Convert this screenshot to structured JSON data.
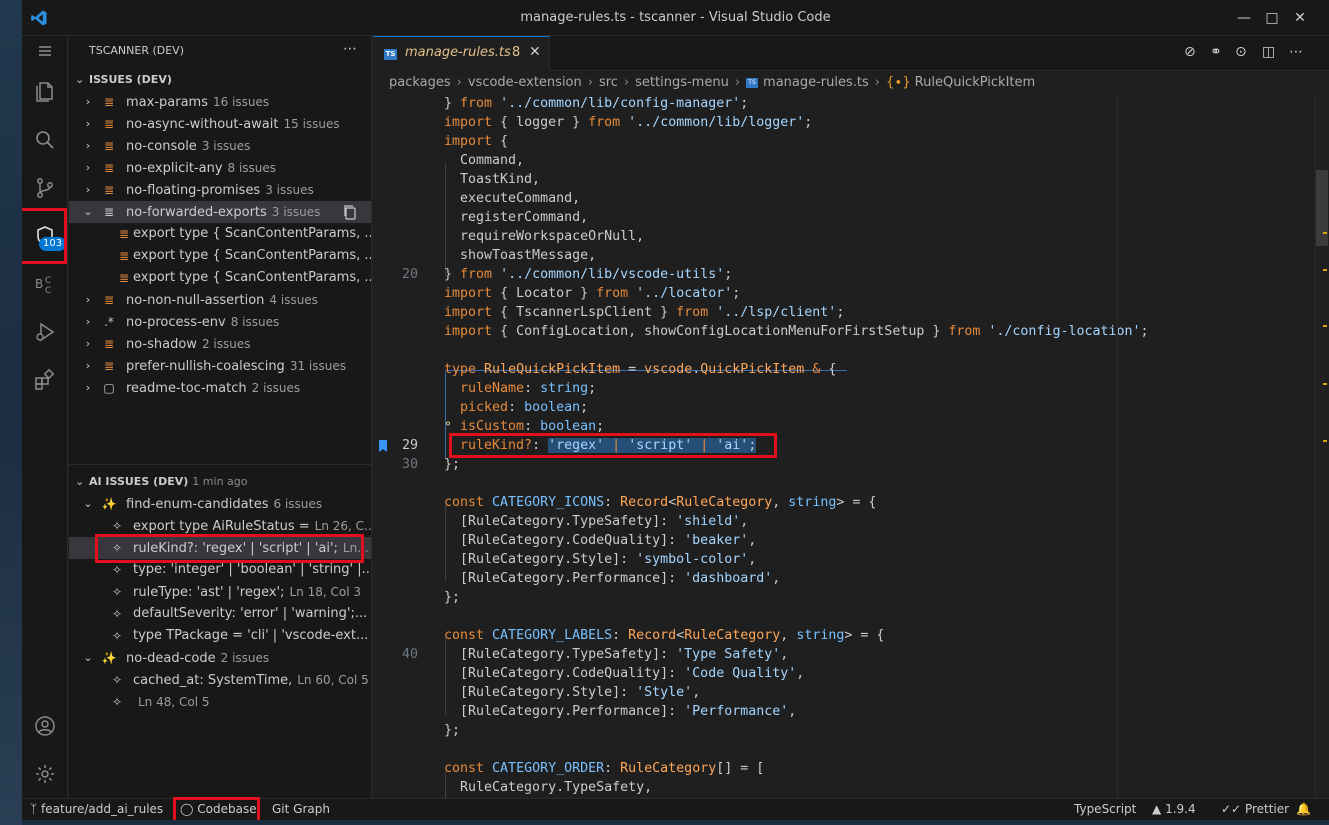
{
  "window": {
    "title": "manage-rules.ts - tscanner - Visual Studio Code"
  },
  "activity": {
    "badge": "103"
  },
  "sidebar": {
    "header": "TSCANNER (DEV)",
    "issues_section": "ISSUES (DEV)",
    "rules": [
      {
        "name": "max-params",
        "count": "16 issues"
      },
      {
        "name": "no-async-without-await",
        "count": "15 issues"
      },
      {
        "name": "no-console",
        "count": "3 issues"
      },
      {
        "name": "no-explicit-any",
        "count": "8 issues"
      },
      {
        "name": "no-floating-promises",
        "count": "3 issues"
      },
      {
        "name": "no-forwarded-exports",
        "count": "3 issues"
      }
    ],
    "forwarded_children": [
      "export type { ScanContentParams, ...",
      "export type { ScanContentParams, ...",
      "export type { ScanContentParams, ..."
    ],
    "rules2": [
      {
        "name": "no-non-null-assertion",
        "count": "4 issues"
      },
      {
        "name": "no-process-env",
        "count": "8 issues"
      },
      {
        "name": "no-shadow",
        "count": "2 issues"
      },
      {
        "name": "prefer-nullish-coalescing",
        "count": "31 issues"
      },
      {
        "name": "readme-toc-match",
        "count": "2 issues"
      }
    ],
    "ai_section": "AI ISSUES (DEV)",
    "ai_time": "1 min ago",
    "ai_rule1": {
      "name": "find-enum-candidates",
      "count": "6 issues"
    },
    "ai_items": [
      {
        "text": "export type AiRuleStatus =",
        "meta": "Ln 26, C..."
      },
      {
        "text": "ruleKind?: 'regex' | 'script' | 'ai';",
        "meta": "Ln..."
      },
      {
        "text": "type: 'integer' | 'boolean' | 'string' |...",
        "meta": ""
      },
      {
        "text": "ruleType: 'ast' | 'regex';",
        "meta": "Ln 18, Col 3"
      },
      {
        "text": "defaultSeverity: 'error' | 'warning';...",
        "meta": ""
      },
      {
        "text": "type TPackage = 'cli' | 'vscode-ext...",
        "meta": ""
      }
    ],
    "ai_rule2": {
      "name": "no-dead-code",
      "count": "2 issues"
    },
    "ai_items2": [
      {
        "text": "cached_at: SystemTime,",
        "meta": "Ln 60, Col 5"
      },
      {
        "text": "",
        "meta": "Ln 48, Col 5"
      }
    ]
  },
  "editor": {
    "tab": {
      "name": "manage-rules.ts",
      "problems": "8",
      "icon": "TS"
    },
    "breadcrumb": [
      "packages",
      "vscode-extension",
      "src",
      "settings-menu",
      "manage-rules.ts",
      "RuleQuickPickItem"
    ],
    "line_numbers": {
      "l20": "20",
      "l29": "29",
      "l30": "30",
      "l40": "40"
    }
  },
  "status": {
    "branch": "feature/add_ai_rules",
    "codebase": "Codebase",
    "git_graph": "Git Graph",
    "language": "TypeScript",
    "version": "1.9.4",
    "prettier": "Prettier"
  },
  "colors": {
    "accent": "#0078d4",
    "highlight": "#e0111c",
    "modified": "#e2c08d"
  }
}
